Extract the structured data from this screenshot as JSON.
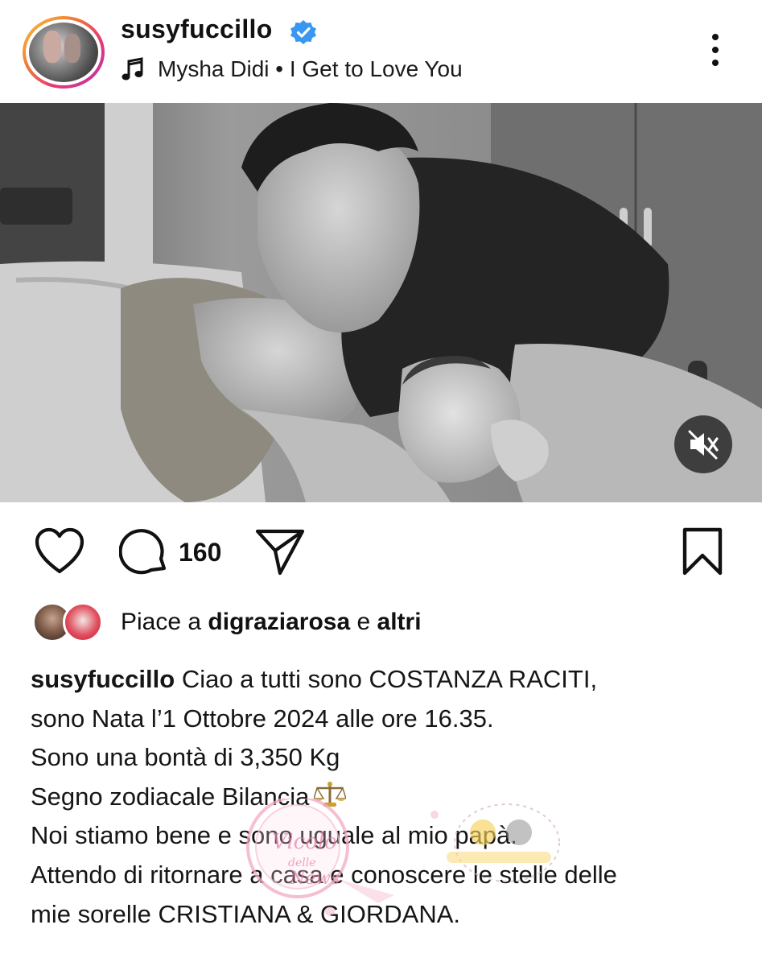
{
  "post": {
    "username": "susyfuccillo",
    "verified": true,
    "music": "Mysha Didi • I Get to Love You",
    "comment_count": "160",
    "likes": {
      "prefix": "Piace a",
      "liker": "digraziarosa",
      "connector": "e",
      "others": "altri"
    },
    "caption": {
      "username": "susyfuccillo",
      "lines": [
        "Ciao a tutti sono COSTANZA RACITI,",
        "sono Nata l’1 Ottobre 2024 alle ore 16.35.",
        "Sono una bontà di 3,350 Kg",
        "Segno zodiacale Bilancia",
        "Noi stiamo bene e sono uguale al mio papà.",
        "Attendo di ritornare a casa e conoscere le stelle delle",
        "mie sorelle CRISTIANA & GIORDANA."
      ]
    },
    "watermark": "Vicolo delle News"
  },
  "icons": {
    "verified": "verified-badge-icon",
    "music": "music-note-icon",
    "more": "more-vertical-icon",
    "mute": "speaker-muted-icon",
    "like": "heart-icon",
    "comment": "comment-icon",
    "share": "send-icon",
    "save": "bookmark-icon",
    "zodiac": "libra-scales-emoji"
  },
  "colors": {
    "verified_blue": "#3897f0",
    "story_ring_start": "#f9c935",
    "story_ring_end": "#b72fbd",
    "text": "#111111"
  }
}
